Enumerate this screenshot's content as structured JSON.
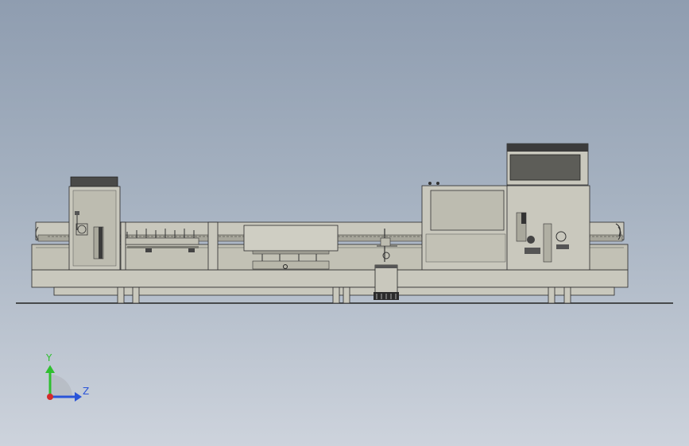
{
  "viewport": {
    "background_top": "#8f9db0",
    "background_bottom": "#cdd3dc"
  },
  "model": {
    "body_color": "#c9c8bd",
    "panel_color": "#b8b7aa",
    "dark_color": "#3c3c3c",
    "line_color": "#2a2a2a"
  },
  "triad": {
    "y_label": "Y",
    "z_label": "Z",
    "y_color": "#2fbf2f",
    "z_color": "#2a54d8",
    "x_color": "#d42a2a"
  }
}
